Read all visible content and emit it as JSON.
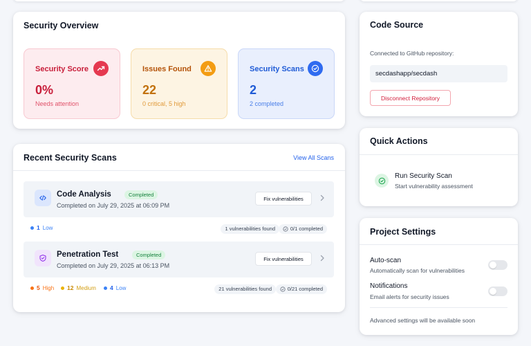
{
  "overview": {
    "title": "Security Overview",
    "stats": [
      {
        "label": "Security Score",
        "value": "0%",
        "sub": "Needs attention",
        "icon": "trending-up-icon"
      },
      {
        "label": "Issues Found",
        "value": "22",
        "sub": "0 critical, 5 high",
        "icon": "warning-triangle-icon"
      },
      {
        "label": "Security Scans",
        "value": "2",
        "sub": "2 completed",
        "icon": "check-circle-icon"
      }
    ]
  },
  "recent": {
    "title": "Recent Security Scans",
    "view_all": "View All Scans",
    "scans": [
      {
        "name": "Code Analysis",
        "status": "Completed",
        "date": "Completed on July 29, 2025 at 06:09 PM",
        "action": "Fix vulnerabilities",
        "icon": "code-icon",
        "severities": [
          {
            "count": "1",
            "label": "Low",
            "color": "#3b82f6"
          }
        ],
        "found": "1 vulnerabilities found",
        "progress": "0/1 completed"
      },
      {
        "name": "Penetration Test",
        "status": "Completed",
        "date": "Completed on July 29, 2025 at 06:13 PM",
        "action": "Fix vulnerabilities",
        "icon": "shield-icon",
        "severities": [
          {
            "count": "5",
            "label": "High",
            "color": "#f97316"
          },
          {
            "count": "12",
            "label": "Medium",
            "color": "#eab308"
          },
          {
            "count": "4",
            "label": "Low",
            "color": "#3b82f6"
          }
        ],
        "found": "21 vulnerabilities found",
        "progress": "0/21 completed"
      }
    ]
  },
  "code_source": {
    "title": "Code Source",
    "connected_text": "Connected to GitHub repository:",
    "repo": "secdashapp/secdash",
    "disconnect": "Disconnect Repository"
  },
  "quick_actions": {
    "title": "Quick Actions",
    "items": [
      {
        "title": "Run Security Scan",
        "sub": "Start vulnerability assessment",
        "icon": "play-circle-icon"
      }
    ]
  },
  "project_settings": {
    "title": "Project Settings",
    "settings": [
      {
        "label": "Auto-scan",
        "sub": "Automatically scan for vulnerabilities",
        "enabled": false
      },
      {
        "label": "Notifications",
        "sub": "Email alerts for security issues",
        "enabled": false
      }
    ],
    "note": "Advanced settings will be available soon"
  },
  "colors": {
    "accent": "#2563eb",
    "danger": "#d21f3c",
    "success": "#15803d",
    "warning": "#f39c12"
  }
}
